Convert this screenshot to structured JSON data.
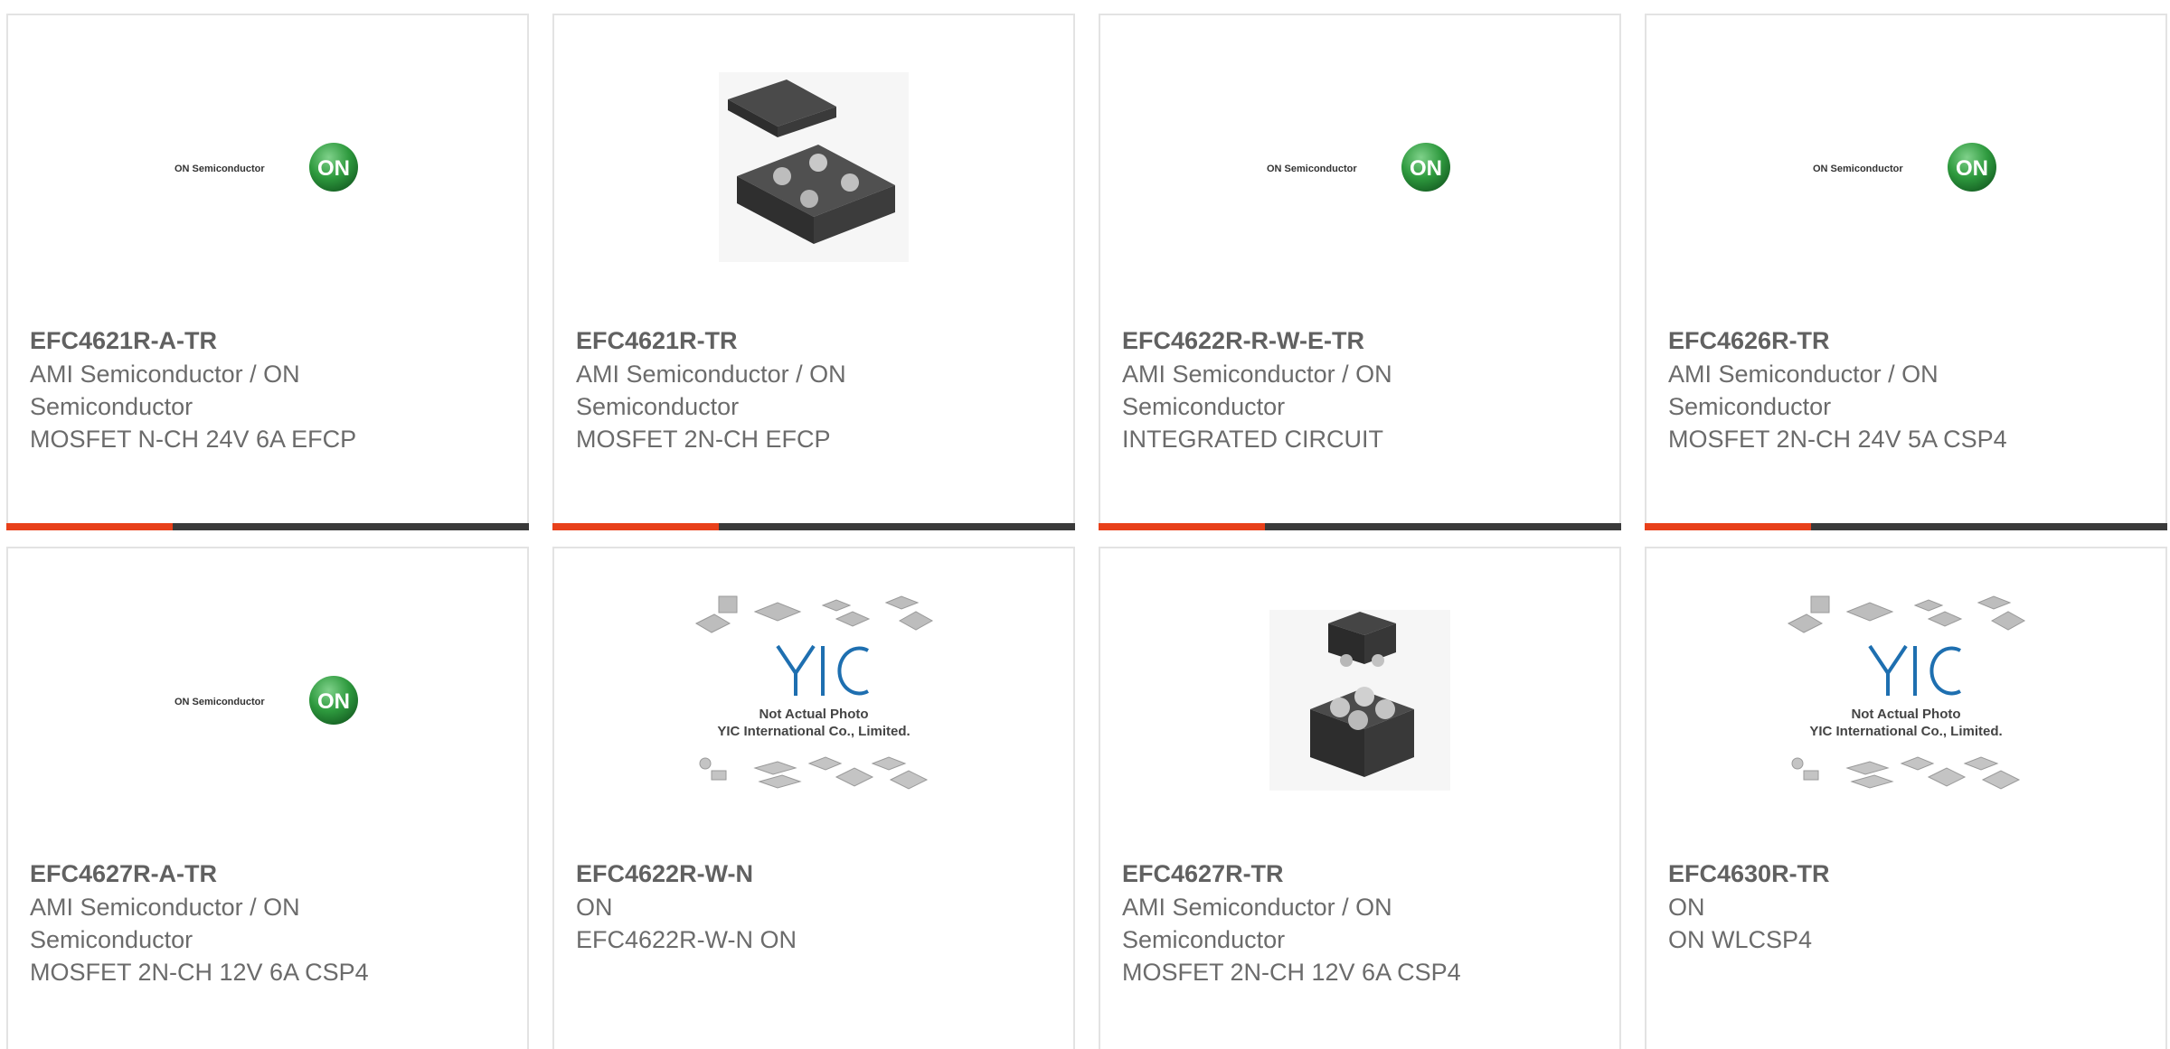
{
  "products": [
    {
      "part_number": "EFC4621R-A-TR",
      "manufacturer": "AMI Semiconductor / ON Semiconductor",
      "description": "MOSFET N-CH 24V 6A EFCP",
      "image": "on-semiconductor-logo",
      "logo_text": "ON Semiconductor",
      "logo_badge": "ON"
    },
    {
      "part_number": "EFC4621R-TR",
      "manufacturer": "AMI Semiconductor / ON Semiconductor",
      "description": "MOSFET 2N-CH EFCP",
      "image": "chip-package-photo"
    },
    {
      "part_number": "EFC4622R-R-W-E-TR",
      "manufacturer": "AMI Semiconductor / ON Semiconductor",
      "description": "INTEGRATED CIRCUIT",
      "image": "on-semiconductor-logo",
      "logo_text": "ON Semiconductor",
      "logo_badge": "ON"
    },
    {
      "part_number": "EFC4626R-TR",
      "manufacturer": "AMI Semiconductor / ON Semiconductor",
      "description": "MOSFET 2N-CH 24V 5A CSP4",
      "image": "on-semiconductor-logo",
      "logo_text": "ON Semiconductor",
      "logo_badge": "ON"
    },
    {
      "part_number": "EFC4627R-A-TR",
      "manufacturer": "AMI Semiconductor / ON Semiconductor",
      "description": "MOSFET 2N-CH 12V 6A CSP4",
      "image": "on-semiconductor-logo",
      "logo_text": "ON Semiconductor",
      "logo_badge": "ON"
    },
    {
      "part_number": "EFC4622R-W-N",
      "manufacturer": "ON",
      "description": "EFC4622R-W-N ON",
      "image": "not-actual-photo-placeholder",
      "placeholder_line1": "Not Actual Photo",
      "placeholder_line2": "YIC International Co., Limited.",
      "placeholder_logo": "YIC"
    },
    {
      "part_number": "EFC4627R-TR",
      "manufacturer": "AMI Semiconductor / ON Semiconductor",
      "description": "MOSFET 2N-CH 12V 6A CSP4",
      "image": "chip-package-photo"
    },
    {
      "part_number": "EFC4630R-TR",
      "manufacturer": "ON",
      "description": "ON WLCSP4",
      "image": "not-actual-photo-placeholder",
      "placeholder_line1": "Not Actual Photo",
      "placeholder_line2": "YIC International Co., Limited.",
      "placeholder_logo": "YIC"
    }
  ],
  "colors": {
    "accent": "#e8401a",
    "bar": "#3a3a3a",
    "text": "#6b6b6b",
    "on_green": "#2e9a3e"
  }
}
